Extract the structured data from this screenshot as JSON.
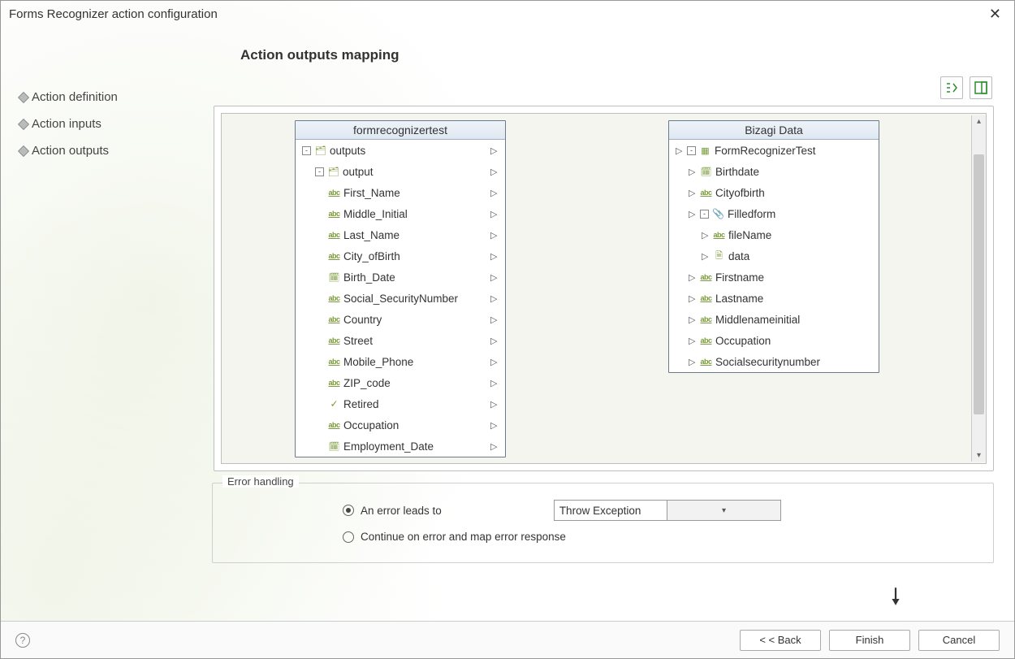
{
  "window": {
    "title": "Forms Recognizer action configuration"
  },
  "sidebar": {
    "items": [
      {
        "label": "Action definition"
      },
      {
        "label": "Action inputs"
      },
      {
        "label": "Action outputs"
      }
    ]
  },
  "heading": "Action outputs mapping",
  "left_panel": {
    "title": "formrecognizertest",
    "rows": [
      {
        "label": "outputs",
        "depth": 1,
        "kind": "container",
        "exp": "-"
      },
      {
        "label": "output",
        "depth": 2,
        "kind": "container",
        "exp": "-"
      },
      {
        "label": "First_Name",
        "depth": 3,
        "kind": "abc"
      },
      {
        "label": "Middle_Initial",
        "depth": 3,
        "kind": "abc"
      },
      {
        "label": "Last_Name",
        "depth": 3,
        "kind": "abc"
      },
      {
        "label": "City_ofBirth",
        "depth": 3,
        "kind": "abc"
      },
      {
        "label": "Birth_Date",
        "depth": 3,
        "kind": "date"
      },
      {
        "label": "Social_SecurityNumber",
        "depth": 3,
        "kind": "abc"
      },
      {
        "label": "Country",
        "depth": 3,
        "kind": "abc"
      },
      {
        "label": "Street",
        "depth": 3,
        "kind": "abc"
      },
      {
        "label": "Mobile_Phone",
        "depth": 3,
        "kind": "abc"
      },
      {
        "label": "ZIP_code",
        "depth": 3,
        "kind": "abc"
      },
      {
        "label": "Retired",
        "depth": 3,
        "kind": "check"
      },
      {
        "label": "Occupation",
        "depth": 3,
        "kind": "abc"
      },
      {
        "label": "Employment_Date",
        "depth": 3,
        "kind": "date"
      }
    ]
  },
  "right_panel": {
    "title": "Bizagi Data",
    "rows": [
      {
        "label": "FormRecognizerTest",
        "depth": 1,
        "kind": "entity",
        "exp": "-"
      },
      {
        "label": "Birthdate",
        "depth": 2,
        "kind": "date"
      },
      {
        "label": "Cityofbirth",
        "depth": 2,
        "kind": "abc"
      },
      {
        "label": "Filledform",
        "depth": 2,
        "kind": "clip",
        "exp": "-"
      },
      {
        "label": "fileName",
        "depth": 3,
        "kind": "abc"
      },
      {
        "label": "data",
        "depth": 3,
        "kind": "doc"
      },
      {
        "label": "Firstname",
        "depth": 2,
        "kind": "abc"
      },
      {
        "label": "Lastname",
        "depth": 2,
        "kind": "abc"
      },
      {
        "label": "Middlenameinitial",
        "depth": 2,
        "kind": "abc"
      },
      {
        "label": "Occupation",
        "depth": 2,
        "kind": "abc"
      },
      {
        "label": "Socialsecuritynumber",
        "depth": 2,
        "kind": "abc"
      }
    ]
  },
  "mappings": [
    {
      "from": 2,
      "to": 6
    },
    {
      "from": 3,
      "to": 8
    },
    {
      "from": 4,
      "to": 7
    },
    {
      "from": 5,
      "to": 2
    },
    {
      "from": 6,
      "to": 1
    },
    {
      "from": 7,
      "to": 10
    },
    {
      "from": 13,
      "to": 9
    }
  ],
  "error": {
    "legend": "Error handling",
    "opt_error": "An error leads to",
    "opt_continue": "Continue on error and map error response",
    "selected": "opt_error",
    "combo_value": "Throw Exception"
  },
  "footer": {
    "back": "< < Back",
    "finish": "Finish",
    "cancel": "Cancel"
  }
}
